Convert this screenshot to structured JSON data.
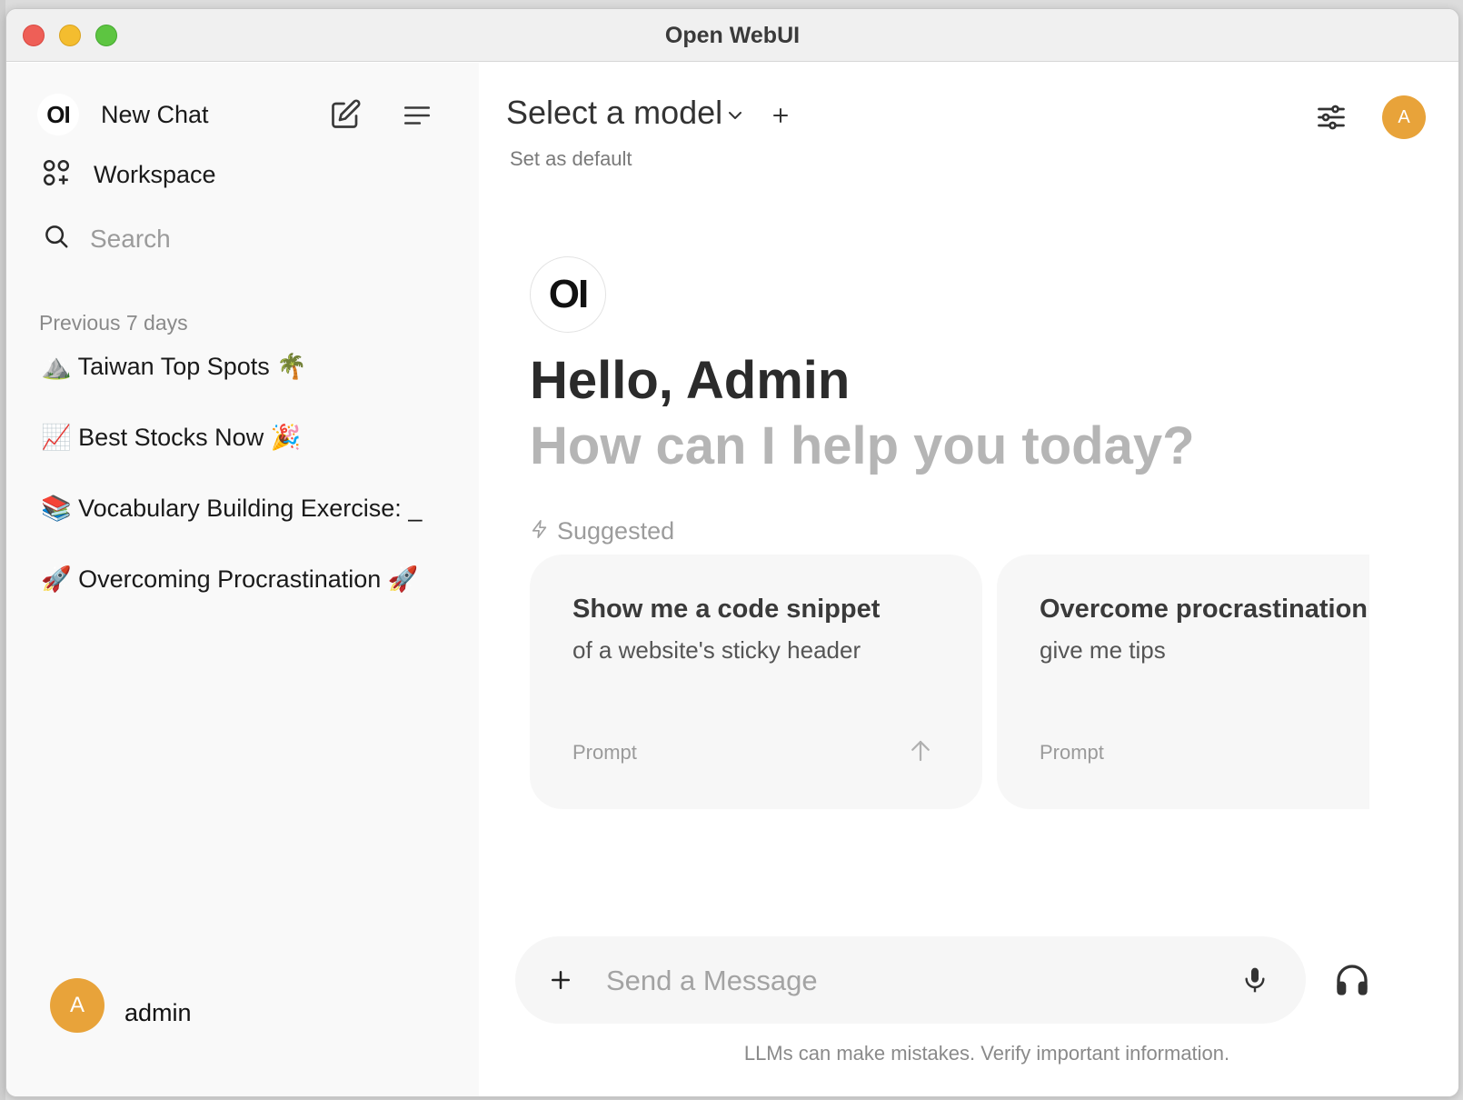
{
  "window": {
    "title": "Open WebUI"
  },
  "sidebar": {
    "logo_text": "OI",
    "new_chat_label": "New Chat",
    "workspace_label": "Workspace",
    "search_placeholder": "Search",
    "section_heading": "Previous 7 days",
    "chats": [
      {
        "label": "⛰️ Taiwan Top Spots 🌴"
      },
      {
        "label": "📈 Best Stocks Now 🎉"
      },
      {
        "label": "📚 Vocabulary Building Exercise: _"
      },
      {
        "label": "🚀 Overcoming Procrastination 🚀"
      }
    ],
    "user": {
      "avatar_initial": "A",
      "name": "admin"
    }
  },
  "header": {
    "model_title": "Select a model",
    "set_default": "Set as default",
    "avatar_initial": "A"
  },
  "hero": {
    "logo_text": "OI",
    "greeting": "Hello, Admin",
    "subtitle": "How can I help you today?"
  },
  "suggested": {
    "label": "Suggested",
    "cards": [
      {
        "title": "Show me a code snippet",
        "subtitle": "of a website's sticky header",
        "tag": "Prompt"
      },
      {
        "title": "Overcome procrastination",
        "subtitle": "give me tips",
        "tag": "Prompt"
      }
    ]
  },
  "composer": {
    "placeholder": "Send a Message",
    "disclaimer": "LLMs can make mistakes. Verify important information."
  },
  "colors": {
    "accent_avatar": "#e8a33a",
    "sidebar_bg": "#f9f9f9"
  },
  "icons": [
    "compose-icon",
    "menu-lines-icon",
    "workspace-grid-icon",
    "search-icon",
    "chevron-down-icon",
    "plus-icon",
    "controls-sliders-icon",
    "zap-icon",
    "arrow-up-icon",
    "microphone-icon",
    "headphones-icon"
  ]
}
